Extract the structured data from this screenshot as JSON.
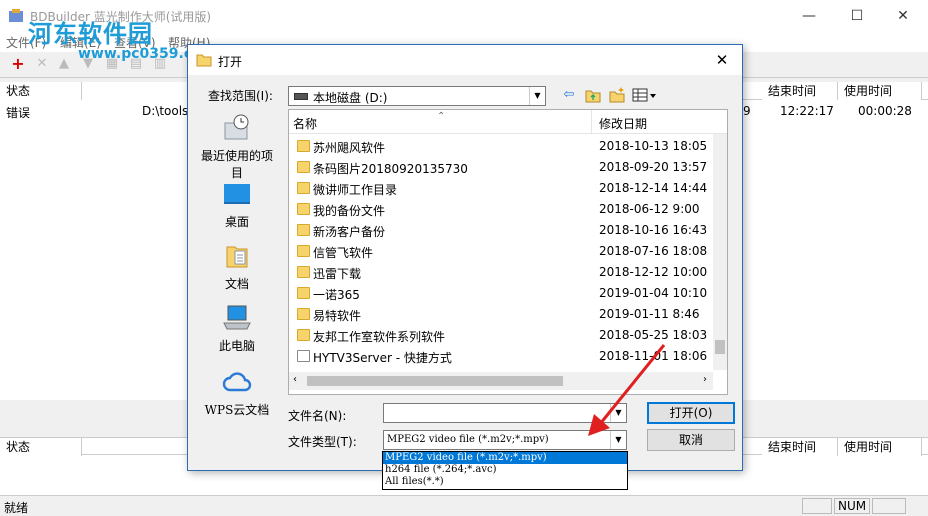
{
  "app": {
    "title": "BDBuilder 蓝光制作大师(试用版)",
    "menu": [
      "文件(F)",
      "编辑(E)",
      "查看(V)",
      "帮助(H)"
    ],
    "window_controls": [
      "—",
      "☐",
      "✕"
    ],
    "top_grid": {
      "headers": [
        "状态",
        "结束时间",
        "使用时间"
      ],
      "row": {
        "status": "错误",
        "path": "D:\\tools",
        "end_fragment": "9",
        "end_time": "12:22:17",
        "used_time": "00:00:28"
      }
    },
    "bottom_grid": {
      "headers": [
        "状态",
        "结束时间",
        "使用时间"
      ]
    },
    "statusbar": {
      "left": "就绪",
      "num": "NUM"
    }
  },
  "watermark": {
    "text": "河东软件园",
    "url": "www.pc0359.cn"
  },
  "dialog": {
    "title": "打开",
    "close": "✕",
    "lookin_label": "查找范围(I):",
    "lookin_value": "本地磁盘 (D:)",
    "places": [
      {
        "label": "最近使用的项目",
        "icon": "recent-icon"
      },
      {
        "label": "桌面",
        "icon": "desktop-icon"
      },
      {
        "label": "文档",
        "icon": "documents-icon"
      },
      {
        "label": "此电脑",
        "icon": "computer-icon"
      },
      {
        "label": "WPS云文档",
        "icon": "cloud-icon"
      }
    ],
    "list_headers": {
      "name": "名称",
      "date": "修改日期"
    },
    "files": [
      {
        "name": "苏州飓风软件",
        "date": "2018-10-13 18:05"
      },
      {
        "name": "条码图片20180920135730",
        "date": "2018-09-20 13:57"
      },
      {
        "name": "微讲师工作目录",
        "date": "2018-12-14 14:44"
      },
      {
        "name": "我的备份文件",
        "date": "2018-06-12 9:00"
      },
      {
        "name": "新汤客户备份",
        "date": "2018-10-16 16:43"
      },
      {
        "name": "信管飞软件",
        "date": "2018-07-16 18:08"
      },
      {
        "name": "迅雷下载",
        "date": "2018-12-12 10:00"
      },
      {
        "name": "一诺365",
        "date": "2019-01-04 10:10"
      },
      {
        "name": "易特软件",
        "date": "2019-01-11 8:46"
      },
      {
        "name": "友邦工作室软件系列软件",
        "date": "2018-05-25 18:03"
      },
      {
        "name": "HYTV3Server - 快捷方式",
        "date": "2018-11-01 18:06"
      }
    ],
    "filename_label": "文件名(N):",
    "filename_value": "",
    "filetype_label": "文件类型(T):",
    "filetype_value": "MPEG2 video file (*.m2v;*.mpv)",
    "open_button": "打开(O)",
    "cancel_button": "取消",
    "filetype_options": [
      "MPEG2 video file (*.m2v;*.mpv)",
      "h264 file (*.264;*.avc)",
      "All files(*.*)"
    ]
  },
  "colors": {
    "accent": "#0078d7",
    "annotation_arrow": "#e02020",
    "watermark": "#1e9cd7"
  }
}
